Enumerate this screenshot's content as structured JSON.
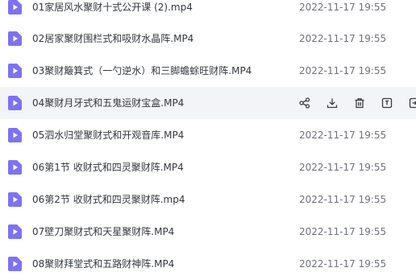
{
  "files": [
    {
      "name": "01家居风水聚财十式公开课 (2).mp4",
      "date": "2022-11-17 19:55"
    },
    {
      "name": "02居家聚财围栏式和吸财水晶阵.MP4",
      "date": "2022-11-17 19:55"
    },
    {
      "name": "03聚财簸箕式（一勺逆水）和三脚蟾蜍旺财阵.MP4",
      "date": "2022-11-17 19:55"
    },
    {
      "name": "04聚财月牙式和五鬼运财宝盒.MP4",
      "date": ""
    },
    {
      "name": "05泗水归堂聚财式和开观音库.MP4",
      "date": "2022-11-17 19:55"
    },
    {
      "name": "06第1节 收财式和四灵聚财阵.MP4",
      "date": "2022-11-17 19:55"
    },
    {
      "name": "06第2节 收财式和四灵聚财阵.mp4",
      "date": "2022-11-17 19:55"
    },
    {
      "name": "07壁刀聚财式和天星聚财阵.MP4",
      "date": "2022-11-17 19:55"
    },
    {
      "name": "08聚财拜堂式和五路财神阵.MP4",
      "date": "2022-11-17 19:55"
    }
  ],
  "hovered_row_index": 3,
  "row_actions": [
    "share-icon",
    "download-icon",
    "delete-icon",
    "rename-icon",
    "more-icon"
  ],
  "colors": {
    "video_icon": "#7b73f2",
    "hover_background": "#f3f4f7",
    "action_icon": "#3a3d44",
    "name_text": "#33373d",
    "date_text": "#6f727a"
  }
}
